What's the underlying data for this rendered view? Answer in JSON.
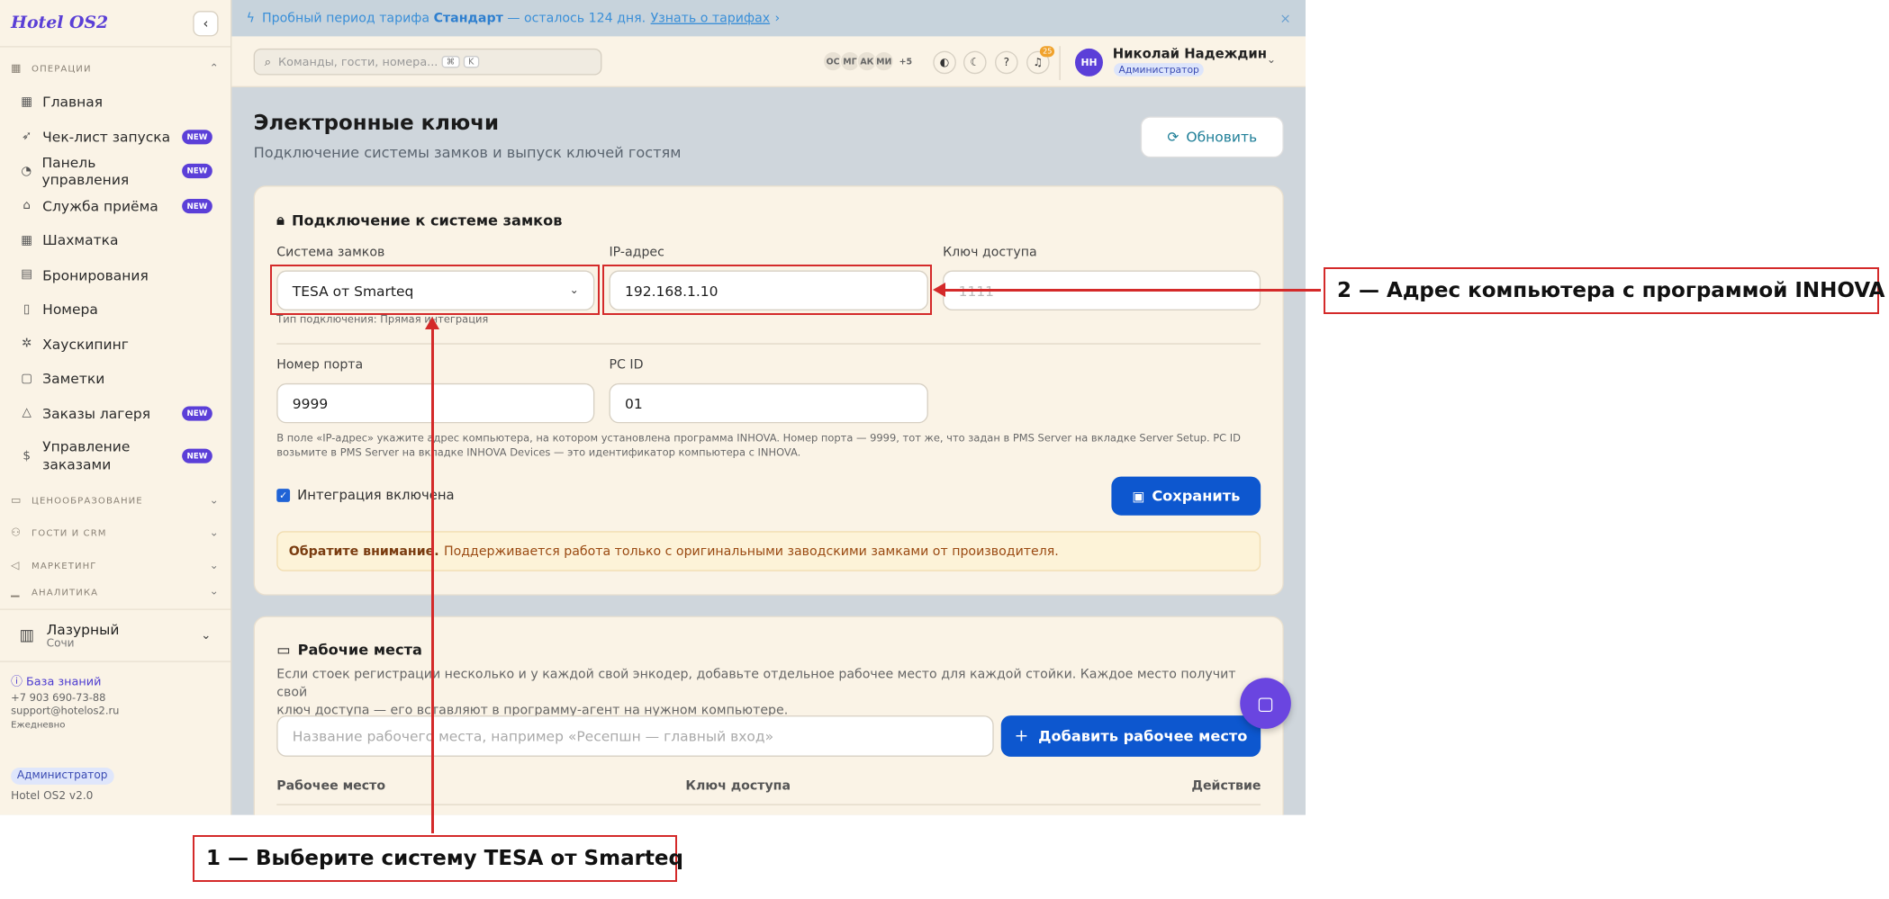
{
  "sidebar": {
    "brand": "Hotel OS2",
    "collapse_icon": "‹",
    "sections": {
      "operations": "ОПЕРАЦИИ",
      "pricing": "ЦЕНООБРАЗОВАНИЕ",
      "guests": "ГОСТИ И CRM",
      "marketing": "МАРКЕТИНГ",
      "analytics": "АНАЛИТИКА"
    },
    "items": [
      {
        "label": "Главная",
        "icon": "grid-icon",
        "badge": ""
      },
      {
        "label": "Чек-лист запуска",
        "icon": "rocket-icon",
        "badge": "NEW"
      },
      {
        "label": "Панель управления",
        "icon": "gauge-icon",
        "badge": "NEW"
      },
      {
        "label": "Служба приёма",
        "icon": "bell-icon",
        "badge": "NEW"
      },
      {
        "label": "Шахматка",
        "icon": "table-icon",
        "badge": ""
      },
      {
        "label": "Бронирования",
        "icon": "clipboard-icon",
        "badge": ""
      },
      {
        "label": "Номера",
        "icon": "door-icon",
        "badge": ""
      },
      {
        "label": "Хаускипинг",
        "icon": "sparkle-icon",
        "badge": ""
      },
      {
        "label": "Заметки",
        "icon": "note-icon",
        "badge": ""
      },
      {
        "label": "Заказы лагеря",
        "icon": "tent-icon",
        "badge": "NEW"
      },
      {
        "label": "Управление заказами",
        "icon": "receipt-icon",
        "badge": "NEW"
      }
    ],
    "hotel": {
      "name": "Лазурный",
      "city": "Сочи"
    },
    "footer": {
      "knowledge_base": "База знаний",
      "phone": "+7 903 690-73-88",
      "email": "support@hotelos2.ru",
      "schedule": "Ежедневно"
    },
    "role": "Администратор",
    "version": "Hotel OS2 v2.0"
  },
  "banner": {
    "prefix": "Пробный период тарифа",
    "plan": "Стандарт",
    "suffix": "— осталось 124 дня.",
    "link": "Узнать о тарифах",
    "close": "×"
  },
  "topbar": {
    "search_placeholder": "Команды, гости, номера...",
    "kbd1": "⌘",
    "kbd2": "K",
    "avatars": [
      "ОС",
      "МГ",
      "АК",
      "МИ"
    ],
    "avatars_more": "+5",
    "notif_count": "25",
    "user": {
      "initials": "НН",
      "name": "Николай Надеждин",
      "role": "Администратор"
    }
  },
  "page": {
    "title": "Электронные ключи",
    "subtitle": "Подключение системы замков и выпуск ключей гостям",
    "refresh": "Обновить"
  },
  "lock_card": {
    "title": "Подключение к системе замков",
    "system_label": "Система замков",
    "system_value": "TESA от Smarteq",
    "connection_hint": "Тип подключения: Прямая интеграция",
    "ip_label": "IP-адрес",
    "ip_value": "192.168.1.10",
    "key_label": "Ключ доступа",
    "key_placeholder": "1111",
    "port_label": "Номер порта",
    "port_value": "9999",
    "pcid_label": "PC ID",
    "pcid_value": "01",
    "help_line1": "В поле «IP-адрес» укажите адрес компьютера, на котором установлена программа INHOVA. Номер порта — 9999, тот же, что задан в PMS Server на вкладке Server Setup. PC ID",
    "help_line2": "возьмите в PMS Server на вкладке INHOVA Devices — это идентификатор компьютера с INHOVA.",
    "integration": "Интеграция включена",
    "integration_enabled": true,
    "save": "Сохранить",
    "notice_bold": "Обратите внимание.",
    "notice_text": "Поддерживается работа только с оригинальными заводскими замками от производителя."
  },
  "workplaces_card": {
    "title": "Рабочие места",
    "desc_line1": "Если стоек регистрации несколько и у каждой свой энкодер, добавьте отдельное рабочее место для каждой стойки. Каждое место получит свой",
    "desc_line2": "ключ доступа — его вставляют в программу-агент на нужном компьютере.",
    "input_placeholder": "Название рабочего места, например «Ресепшн — главный вход»",
    "add": "Добавить рабочее место",
    "col_workplace": "Рабочее место",
    "col_key": "Ключ доступа",
    "col_action": "Действие"
  },
  "annotations": {
    "step1": "1 — Выберите систему TESA от Smarteq",
    "step2": "2 — Адрес компьютера с программой INHOVA"
  },
  "colors": {
    "accent": "#0d57cf",
    "brand": "#5b3fd8",
    "annotation": "#d42a2a",
    "notice_bg": "#fdf3d8"
  }
}
